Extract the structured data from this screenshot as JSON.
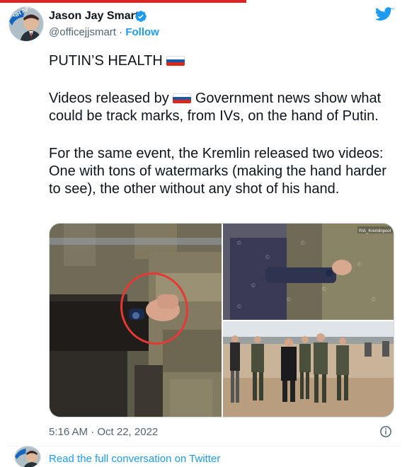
{
  "author": {
    "name": "Jason Jay Smart",
    "handle": "@officejjsmart",
    "separator": " · ",
    "follow_label": "Follow",
    "avatar_badge": "ЧН АРТ"
  },
  "icons": {
    "verified": "verified-badge-icon",
    "brand": "twitter-bird-icon",
    "info": "info-icon",
    "flag": "russia-flag-icon"
  },
  "colors": {
    "link": "#1d9bf0",
    "text": "#0f1419",
    "muted": "#536471",
    "top_bar": "#d62728"
  },
  "tweet": {
    "line1": "PUTIN’S HEALTH",
    "p2_before": "Videos released by",
    "p2_after": "Government news show what could be track marks, from IVs, on the hand of Putin.",
    "p3": "For the same event, the Kremlin released two videos: One with tons of watermarks (making the hand harder to see), the other without any shot of his hand."
  },
  "media": {
    "watermark": "RIA_Kremlinpool"
  },
  "footer": {
    "timestamp": "5:16 AM · Oct 22, 2022",
    "read_more": "Read the full conversation on Twitter"
  }
}
